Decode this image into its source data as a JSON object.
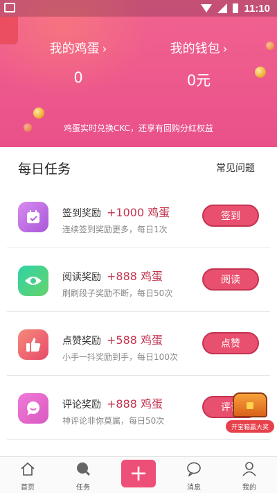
{
  "status_bar": {
    "time": "11:10"
  },
  "wallet": {
    "eggs_label": "我的鸡蛋",
    "eggs_value": "0",
    "wallet_label": "我的钱包",
    "wallet_value": "0元",
    "note": "鸡蛋实时兑换CKC，还享有回购分红权益"
  },
  "daily": {
    "title": "每日任务",
    "faq": "常见问题",
    "tasks": [
      {
        "title": "签到奖励",
        "reward": "+1000 鸡蛋",
        "desc": "连续签到奖励更多，每日1次",
        "button": "签到",
        "icon": "calendar-icon",
        "color": "#c66be0"
      },
      {
        "title": "阅读奖励",
        "reward": "+888 鸡蛋",
        "desc": "刷刷段子奖励不断，每日50次",
        "button": "阅读",
        "icon": "eye-icon",
        "color": "#3fcf8f"
      },
      {
        "title": "点赞奖励",
        "reward": "+588 鸡蛋",
        "desc": "小手一抖奖励到手，每日100次",
        "button": "点赞",
        "icon": "thumbs-up-icon",
        "color": "#f2566a"
      },
      {
        "title": "评论奖励",
        "reward": "+888 鸡蛋",
        "desc": "神评论非你莫属，每日50次",
        "button": "评论",
        "icon": "chat-bubble-icon",
        "color": "#e864c8"
      }
    ]
  },
  "treasure": {
    "label": "开宝箱赢大奖"
  },
  "nav": {
    "home": "首页",
    "tasks": "任务",
    "plus": "+",
    "messages": "消息",
    "me": "我的"
  }
}
